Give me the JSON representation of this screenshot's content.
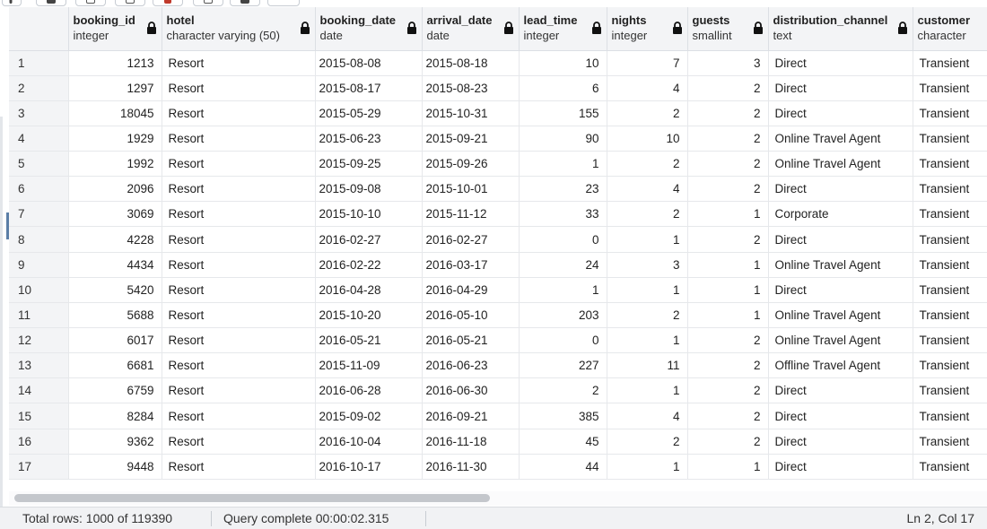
{
  "columns": [
    {
      "name": "booking_id",
      "type": "integer"
    },
    {
      "name": "hotel",
      "type": "character varying (50)"
    },
    {
      "name": "booking_date",
      "type": "date"
    },
    {
      "name": "arrival_date",
      "type": "date"
    },
    {
      "name": "lead_time",
      "type": "integer"
    },
    {
      "name": "nights",
      "type": "integer"
    },
    {
      "name": "guests",
      "type": "smallint"
    },
    {
      "name": "distribution_channel",
      "type": "text"
    },
    {
      "name": "customer",
      "type": "character"
    }
  ],
  "rows": [
    {
      "n": "1",
      "cells": [
        "1213",
        "Resort",
        "2015-08-08",
        "2015-08-18",
        "10",
        "7",
        "3",
        "Direct",
        "Transient"
      ]
    },
    {
      "n": "2",
      "cells": [
        "1297",
        "Resort",
        "2015-08-17",
        "2015-08-23",
        "6",
        "4",
        "2",
        "Direct",
        "Transient"
      ]
    },
    {
      "n": "3",
      "cells": [
        "18045",
        "Resort",
        "2015-05-29",
        "2015-10-31",
        "155",
        "2",
        "2",
        "Direct",
        "Transient"
      ]
    },
    {
      "n": "4",
      "cells": [
        "1929",
        "Resort",
        "2015-06-23",
        "2015-09-21",
        "90",
        "10",
        "2",
        "Online Travel Agent",
        "Transient"
      ]
    },
    {
      "n": "5",
      "cells": [
        "1992",
        "Resort",
        "2015-09-25",
        "2015-09-26",
        "1",
        "2",
        "2",
        "Online Travel Agent",
        "Transient"
      ]
    },
    {
      "n": "6",
      "cells": [
        "2096",
        "Resort",
        "2015-09-08",
        "2015-10-01",
        "23",
        "4",
        "2",
        "Direct",
        "Transient"
      ]
    },
    {
      "n": "7",
      "cells": [
        "3069",
        "Resort",
        "2015-10-10",
        "2015-11-12",
        "33",
        "2",
        "1",
        "Corporate",
        "Transient"
      ]
    },
    {
      "n": "8",
      "cells": [
        "4228",
        "Resort",
        "2016-02-27",
        "2016-02-27",
        "0",
        "1",
        "2",
        "Direct",
        "Transient"
      ]
    },
    {
      "n": "9",
      "cells": [
        "4434",
        "Resort",
        "2016-02-22",
        "2016-03-17",
        "24",
        "3",
        "1",
        "Online Travel Agent",
        "Transient"
      ]
    },
    {
      "n": "10",
      "cells": [
        "5420",
        "Resort",
        "2016-04-28",
        "2016-04-29",
        "1",
        "1",
        "1",
        "Direct",
        "Transient"
      ]
    },
    {
      "n": "11",
      "cells": [
        "5688",
        "Resort",
        "2015-10-20",
        "2016-05-10",
        "203",
        "2",
        "1",
        "Online Travel Agent",
        "Transient"
      ]
    },
    {
      "n": "12",
      "cells": [
        "6017",
        "Resort",
        "2016-05-21",
        "2016-05-21",
        "0",
        "1",
        "2",
        "Online Travel Agent",
        "Transient"
      ]
    },
    {
      "n": "13",
      "cells": [
        "6681",
        "Resort",
        "2015-11-09",
        "2016-06-23",
        "227",
        "11",
        "2",
        "Offline Travel Agent",
        "Transient"
      ]
    },
    {
      "n": "14",
      "cells": [
        "6759",
        "Resort",
        "2016-06-28",
        "2016-06-30",
        "2",
        "1",
        "2",
        "Direct",
        "Transient"
      ]
    },
    {
      "n": "15",
      "cells": [
        "8284",
        "Resort",
        "2015-09-02",
        "2016-09-21",
        "385",
        "4",
        "2",
        "Direct",
        "Transient"
      ]
    },
    {
      "n": "16",
      "cells": [
        "9362",
        "Resort",
        "2016-10-04",
        "2016-11-18",
        "45",
        "2",
        "2",
        "Direct",
        "Transient"
      ]
    },
    {
      "n": "17",
      "cells": [
        "9448",
        "Resort",
        "2016-10-17",
        "2016-11-30",
        "44",
        "1",
        "1",
        "Direct",
        "Transient"
      ]
    }
  ],
  "status": {
    "total_rows": "Total rows: 1000 of 119390",
    "query": "Query complete 00:00:02.315",
    "cursor": "Ln 2, Col 17"
  },
  "icons": {
    "column_lock": "lock-icon"
  },
  "colors": {
    "header_bg": "#f3f4f6",
    "grid_line": "#e6e8eb",
    "status_bg": "#f1f2f4",
    "accent_marker": "#5b7ea6"
  }
}
